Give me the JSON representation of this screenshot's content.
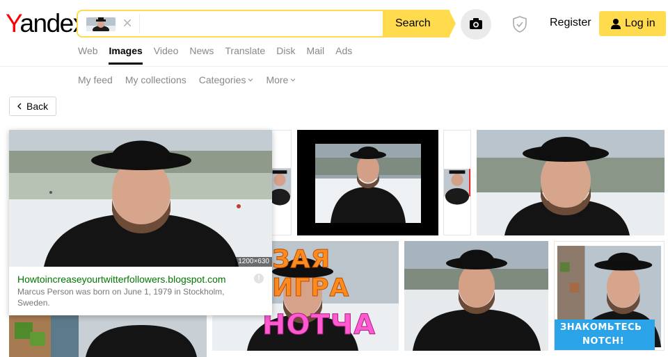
{
  "logo": {
    "first_letter": "Y",
    "rest": "andex"
  },
  "search": {
    "button_label": "Search",
    "query_image": "query-thumbnail"
  },
  "header": {
    "register": "Register",
    "login": "Log in"
  },
  "services": [
    {
      "label": "Web"
    },
    {
      "label": "Images",
      "active": true
    },
    {
      "label": "Video"
    },
    {
      "label": "News"
    },
    {
      "label": "Translate"
    },
    {
      "label": "Disk"
    },
    {
      "label": "Mail"
    },
    {
      "label": "Ads"
    }
  ],
  "sub_nav": [
    {
      "label": "My feed"
    },
    {
      "label": "My collections"
    },
    {
      "label": "Categories"
    },
    {
      "label": "More"
    }
  ],
  "back": {
    "label": "Back"
  },
  "hover_card": {
    "size": "1200×630",
    "host": "Howtoincreaseyourtwitterfollowers.blogspot.com",
    "description": "Marcus Person was born on June 1, 1979 in Stockholm, Sweden.",
    "info": "!"
  },
  "tiles": {
    "meme_orange": "ЗАЯ ИГРА",
    "meme_pink": "НОТЧА",
    "meet_line1": "ЗНАКОМЬТЕСЬ",
    "meet_line2": "NOTCH!"
  },
  "colors": {
    "accent": "#ffdb4d",
    "logo_red": "#ff0000",
    "host_green": "#007700",
    "meme_orange": "#ff8a1e",
    "meme_pink": "#ff5ad0",
    "meet_bg": "#2aa3e8"
  }
}
